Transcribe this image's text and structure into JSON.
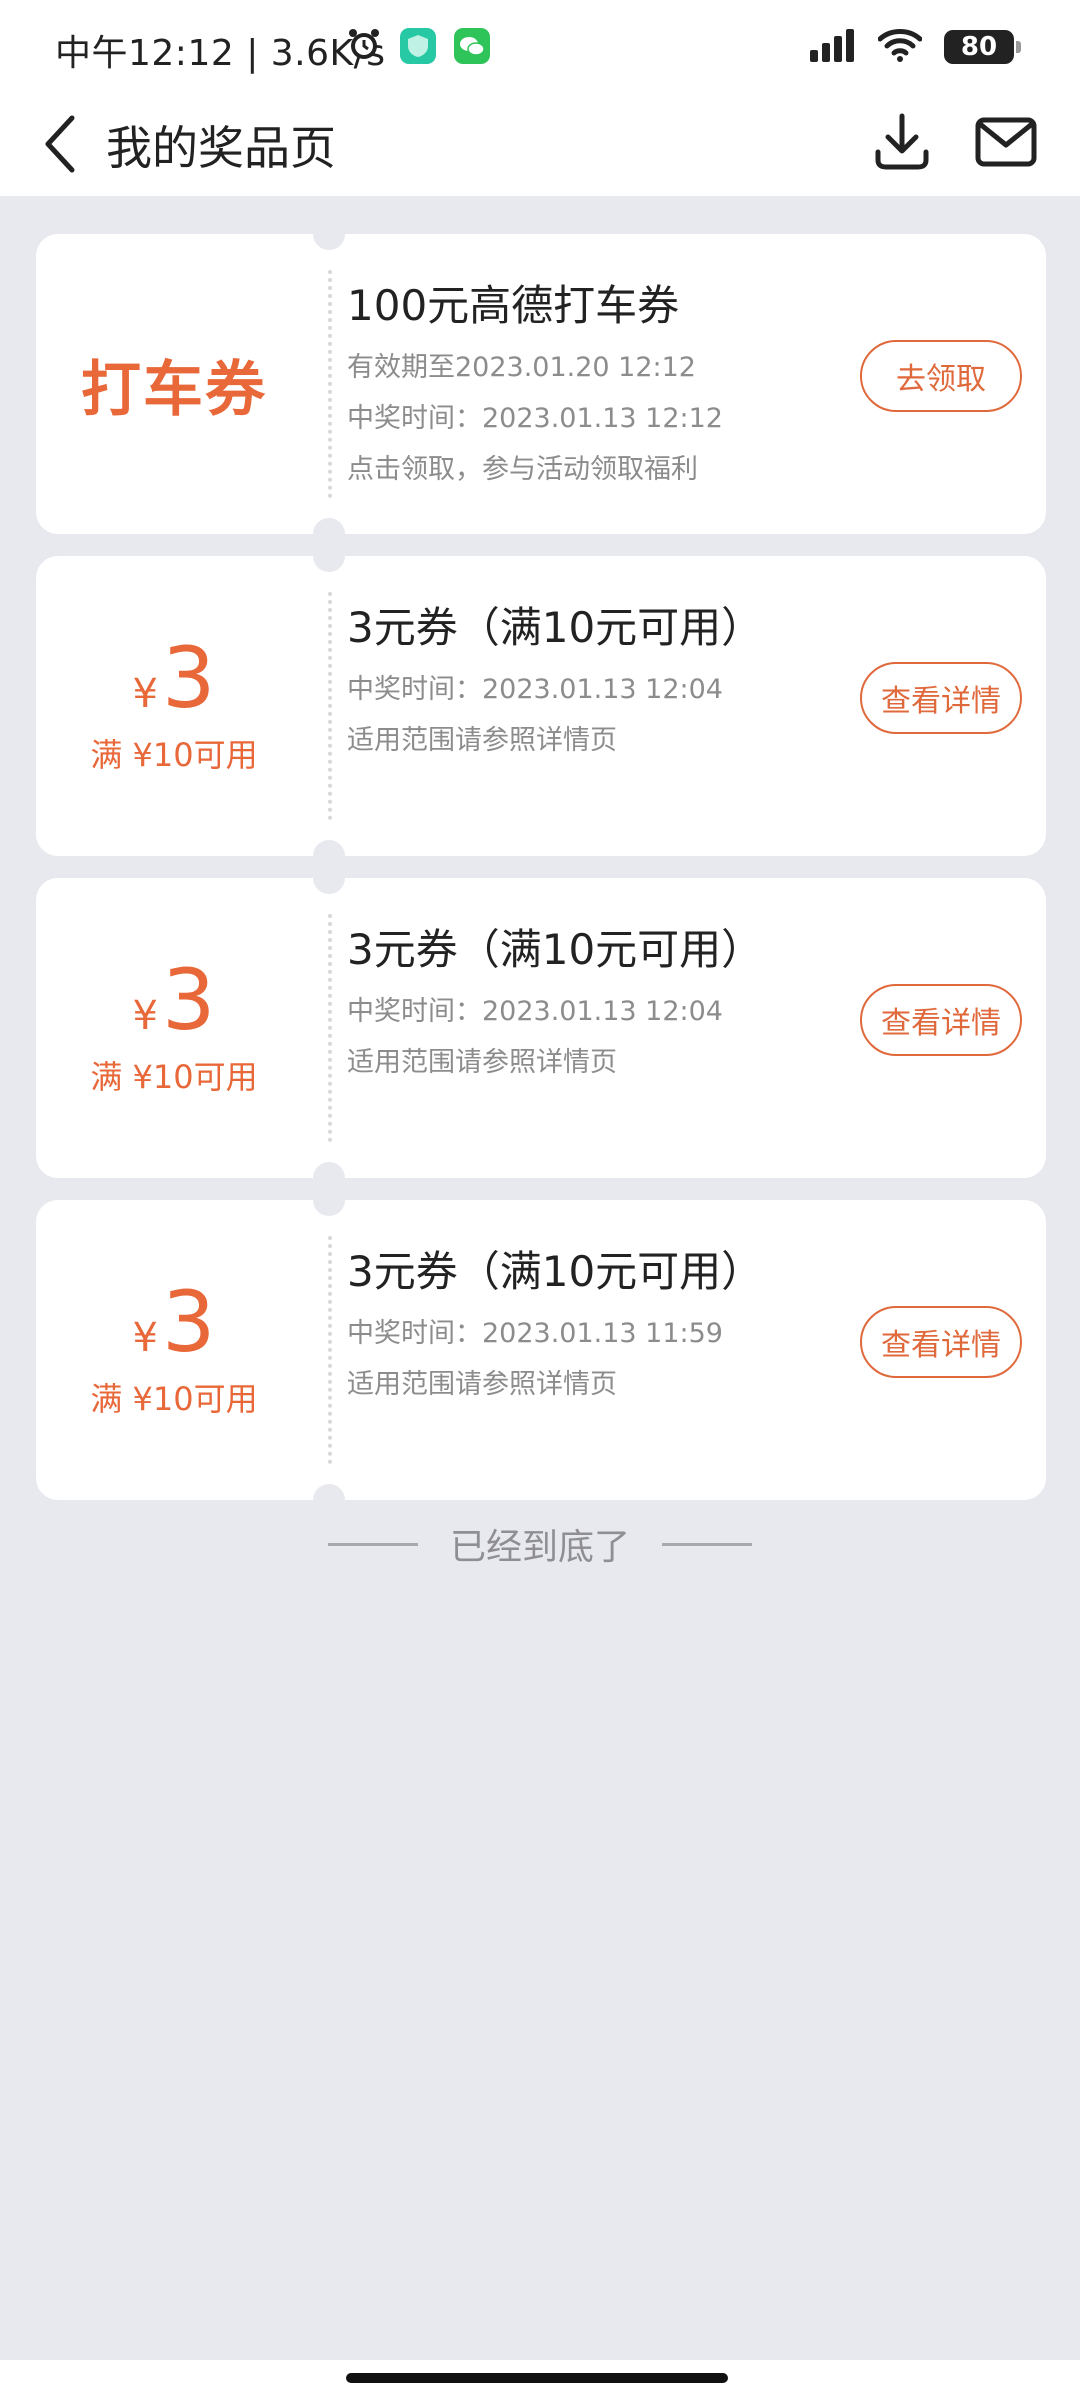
{
  "status_bar": {
    "time_speed": "中午12:12 | 3.6K/s",
    "battery": "80"
  },
  "nav": {
    "title": "我的奖品页"
  },
  "prizes": [
    {
      "left_label": "打车券",
      "title": "100元高德打车券",
      "lines": [
        "有效期至2023.01.20 12:12",
        "中奖时间：2023.01.13 12:12",
        "点击领取，参与活动领取福利"
      ],
      "action": "去领取"
    },
    {
      "currency": "¥",
      "amount": "3",
      "condition": "满 ¥10可用",
      "title": "3元券（满10元可用）",
      "lines": [
        "中奖时间：2023.01.13 12:04",
        "适用范围请参照详情页"
      ],
      "action": "查看详情"
    },
    {
      "currency": "¥",
      "amount": "3",
      "condition": "满 ¥10可用",
      "title": "3元券（满10元可用）",
      "lines": [
        "中奖时间：2023.01.13 12:04",
        "适用范围请参照详情页"
      ],
      "action": "查看详情"
    },
    {
      "currency": "¥",
      "amount": "3",
      "condition": "满 ¥10可用",
      "title": "3元券（满10元可用）",
      "lines": [
        "中奖时间：2023.01.13 11:59",
        "适用范围请参照详情页"
      ],
      "action": "查看详情"
    }
  ],
  "footer": {
    "end_text": "已经到底了"
  },
  "icons": {
    "alarm": "alarm-icon",
    "security_app": "security-app-icon",
    "wechat": "wechat-icon",
    "signal": "signal-icon",
    "wifi": "wifi-icon",
    "back": "back-arrow-icon",
    "download": "download-icon",
    "mail": "mail-icon"
  },
  "colors": {
    "accent": "#e8683a",
    "background": "#e8e9ee",
    "card": "#ffffff",
    "secondary_text": "#8c8c8c"
  }
}
